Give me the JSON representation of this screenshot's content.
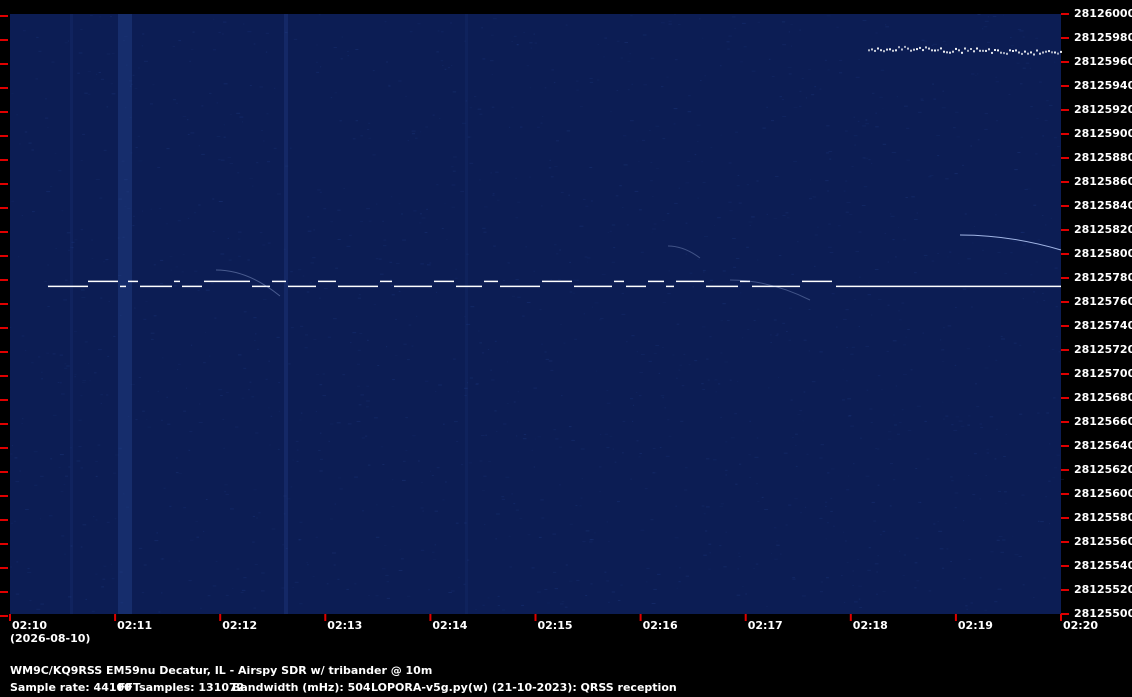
{
  "spectrogram": {
    "colors": {
      "background": "#0c1d54",
      "noise_light": "#1b3579",
      "signal": "#ffffff",
      "tick": "#e00000"
    },
    "frequency_axis": {
      "min": 28125500,
      "max": 28126000,
      "labels": [
        "28126000",
        "28125980",
        "28125960",
        "28125940",
        "28125920",
        "28125900",
        "28125880",
        "28125860",
        "28125840",
        "28125820",
        "28125800",
        "28125780",
        "28125760",
        "28125740",
        "28125720",
        "28125700",
        "28125680",
        "28125660",
        "28125640",
        "28125620",
        "28125600",
        "28125580",
        "28125560",
        "28125540",
        "28125520",
        "28125500"
      ]
    },
    "time_axis": {
      "labels": [
        "02:10",
        "02:11",
        "02:12",
        "02:13",
        "02:14",
        "02:15",
        "02:16",
        "02:17",
        "02:18",
        "02:19",
        "02:20"
      ],
      "date": "(2026-08-10)"
    },
    "signals": [
      {
        "description_type": "qrss-keyed-carrier",
        "frequency": 28125773,
        "start_time": "02:10",
        "end_time": "02:20"
      },
      {
        "description_type": "dotted-trace",
        "frequency": 28125972,
        "start_time": "02:18",
        "end_time": "02:20"
      }
    ]
  },
  "footer": {
    "station": "WM9C/KQ9RSS EM59nu Decatur, IL - Airspy SDR w/ tribander @ 10m",
    "sample_rate": "Sample rate: 44100",
    "fft_samples": "FFTsamples: 131072",
    "bandwidth": "Bandwidth (mHz): 504",
    "software": "LOPORA-v5g.py(w) (21-10-2023): QRSS reception"
  }
}
